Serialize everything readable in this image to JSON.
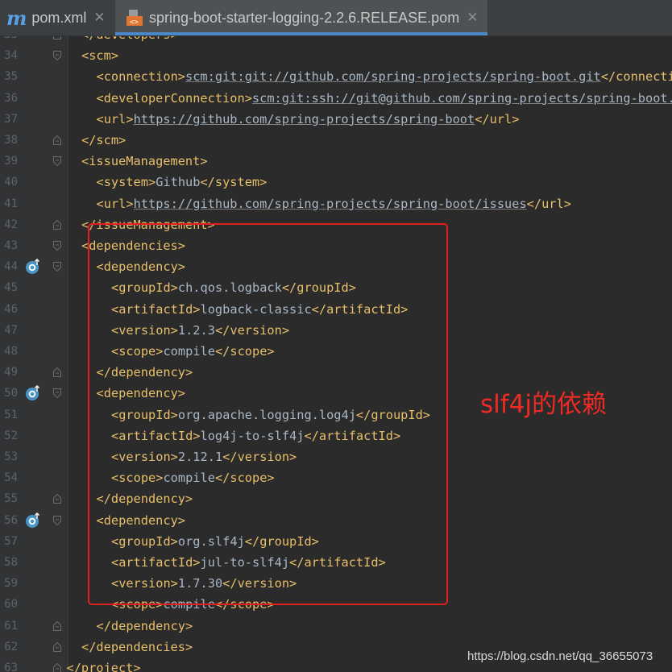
{
  "tabs": [
    {
      "label": "pom.xml",
      "icon": "maven-m-icon"
    },
    {
      "label": "spring-boot-starter-logging-2.2.6.RELEASE.pom",
      "icon": "pom-file-icon",
      "active": true
    }
  ],
  "lines": [
    {
      "num": "33",
      "indent": 1,
      "parts": [
        [
          "tag",
          "</developers>"
        ]
      ],
      "fold": "end"
    },
    {
      "num": "34",
      "indent": 1,
      "parts": [
        [
          "tag",
          "<scm>"
        ]
      ],
      "fold": "start"
    },
    {
      "num": "35",
      "indent": 2,
      "parts": [
        [
          "tag",
          "<connection>"
        ],
        [
          "url",
          "scm:git:git://github.com/spring-projects/spring-boot.git"
        ],
        [
          "tag",
          "</connection>"
        ]
      ]
    },
    {
      "num": "36",
      "indent": 2,
      "parts": [
        [
          "tag",
          "<developerConnection>"
        ],
        [
          "url",
          "scm:git:ssh://git@github.com/spring-projects/spring-boot.git"
        ],
        [
          "tag",
          "</developerConnection>"
        ]
      ]
    },
    {
      "num": "37",
      "indent": 2,
      "parts": [
        [
          "tag",
          "<url>"
        ],
        [
          "url",
          "https://github.com/spring-projects/spring-boot"
        ],
        [
          "tag",
          "</url>"
        ]
      ]
    },
    {
      "num": "38",
      "indent": 1,
      "parts": [
        [
          "tag",
          "</scm>"
        ]
      ],
      "fold": "end"
    },
    {
      "num": "39",
      "indent": 1,
      "parts": [
        [
          "tag",
          "<issueManagement>"
        ]
      ],
      "fold": "start"
    },
    {
      "num": "40",
      "indent": 2,
      "parts": [
        [
          "tag",
          "<system>"
        ],
        [
          "txt",
          "Github"
        ],
        [
          "tag",
          "</system>"
        ]
      ]
    },
    {
      "num": "41",
      "indent": 2,
      "parts": [
        [
          "tag",
          "<url>"
        ],
        [
          "url",
          "https://github.com/spring-projects/spring-boot/issues"
        ],
        [
          "tag",
          "</url>"
        ]
      ]
    },
    {
      "num": "42",
      "indent": 1,
      "parts": [
        [
          "tag",
          "</issueManagement>"
        ]
      ],
      "fold": "end"
    },
    {
      "num": "43",
      "indent": 1,
      "parts": [
        [
          "tag",
          "<dependencies>"
        ]
      ],
      "fold": "start"
    },
    {
      "num": "44",
      "indent": 2,
      "parts": [
        [
          "tag",
          "<dependency>"
        ]
      ],
      "fold": "start",
      "marker": true
    },
    {
      "num": "45",
      "indent": 3,
      "parts": [
        [
          "tag",
          "<groupId>"
        ],
        [
          "txt",
          "ch.qos.logback"
        ],
        [
          "tag",
          "</groupId>"
        ]
      ]
    },
    {
      "num": "46",
      "indent": 3,
      "parts": [
        [
          "tag",
          "<artifactId>"
        ],
        [
          "txt",
          "logback-classic"
        ],
        [
          "tag",
          "</artifactId>"
        ]
      ]
    },
    {
      "num": "47",
      "indent": 3,
      "parts": [
        [
          "tag",
          "<version>"
        ],
        [
          "txt",
          "1.2.3"
        ],
        [
          "tag",
          "</version>"
        ]
      ]
    },
    {
      "num": "48",
      "indent": 3,
      "parts": [
        [
          "tag",
          "<scope>"
        ],
        [
          "txt",
          "compile"
        ],
        [
          "tag",
          "</scope>"
        ]
      ]
    },
    {
      "num": "49",
      "indent": 2,
      "parts": [
        [
          "tag",
          "</dependency>"
        ]
      ],
      "fold": "end"
    },
    {
      "num": "50",
      "indent": 2,
      "parts": [
        [
          "tag",
          "<dependency>"
        ]
      ],
      "fold": "start",
      "marker": true
    },
    {
      "num": "51",
      "indent": 3,
      "parts": [
        [
          "tag",
          "<groupId>"
        ],
        [
          "txt",
          "org.apache.logging.log4j"
        ],
        [
          "tag",
          "</groupId>"
        ]
      ]
    },
    {
      "num": "52",
      "indent": 3,
      "parts": [
        [
          "tag",
          "<artifactId>"
        ],
        [
          "txt",
          "log4j-to-slf4j"
        ],
        [
          "tag",
          "</artifactId>"
        ]
      ]
    },
    {
      "num": "53",
      "indent": 3,
      "parts": [
        [
          "tag",
          "<version>"
        ],
        [
          "txt",
          "2.12.1"
        ],
        [
          "tag",
          "</version>"
        ]
      ]
    },
    {
      "num": "54",
      "indent": 3,
      "parts": [
        [
          "tag",
          "<scope>"
        ],
        [
          "txt",
          "compile"
        ],
        [
          "tag",
          "</scope>"
        ]
      ]
    },
    {
      "num": "55",
      "indent": 2,
      "parts": [
        [
          "tag",
          "</dependency>"
        ]
      ],
      "fold": "end"
    },
    {
      "num": "56",
      "indent": 2,
      "parts": [
        [
          "tag",
          "<dependency>"
        ]
      ],
      "fold": "start",
      "marker": true
    },
    {
      "num": "57",
      "indent": 3,
      "parts": [
        [
          "tag",
          "<groupId>"
        ],
        [
          "txt",
          "org.slf4j"
        ],
        [
          "tag",
          "</groupId>"
        ]
      ]
    },
    {
      "num": "58",
      "indent": 3,
      "parts": [
        [
          "tag",
          "<artifactId>"
        ],
        [
          "txt",
          "jul-to-slf4j"
        ],
        [
          "tag",
          "</artifactId>"
        ]
      ]
    },
    {
      "num": "59",
      "indent": 3,
      "parts": [
        [
          "tag",
          "<version>"
        ],
        [
          "txt",
          "1.7.30"
        ],
        [
          "tag",
          "</version>"
        ]
      ]
    },
    {
      "num": "60",
      "indent": 3,
      "parts": [
        [
          "tag",
          "<scope>"
        ],
        [
          "txt",
          "compile"
        ],
        [
          "tag",
          "</scope>"
        ]
      ]
    },
    {
      "num": "61",
      "indent": 2,
      "parts": [
        [
          "tag",
          "</dependency>"
        ]
      ],
      "fold": "end"
    },
    {
      "num": "62",
      "indent": 1,
      "parts": [
        [
          "tag",
          "</dependencies>"
        ]
      ],
      "fold": "end"
    },
    {
      "num": "63",
      "indent": 0,
      "parts": [
        [
          "tag",
          "</project>"
        ]
      ],
      "fold": "end"
    }
  ],
  "annotation": "slf4j的依赖",
  "watermark": "https://blog.csdn.net/qq_36655073",
  "colors": {
    "tag": "#e8bf6a",
    "text": "#a9b7c6",
    "background": "#2b2b2b",
    "highlight_box": "#e0201e",
    "annotation": "#f02a22"
  }
}
